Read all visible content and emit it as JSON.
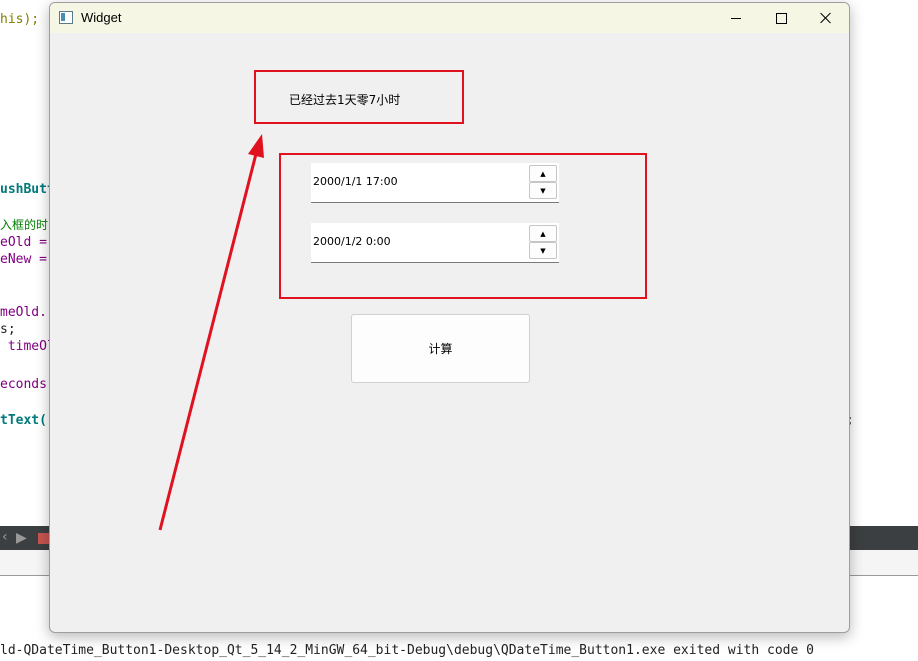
{
  "background_editor": {
    "fragments": [
      {
        "text": "his);",
        "cls": "olive"
      },
      {
        "text": "ushButt",
        "cls": "teal"
      },
      {
        "text": "入框的时",
        "cls": "green"
      },
      {
        "text": "eOld =",
        "cls": "purple"
      },
      {
        "text": "eNew =",
        "cls": "purple"
      },
      {
        "text": "meOld.",
        "cls": "purple"
      },
      {
        "text": "s;",
        "cls": ""
      },
      {
        "text": " timeOl",
        "cls": "purple"
      },
      {
        "text": "econds",
        "cls": "purple"
      },
      {
        "text": "tText(",
        "cls": "teal"
      },
      {
        "text": ";",
        "cls": ""
      }
    ],
    "toolbar_glyphs": [
      "‹",
      "▶"
    ]
  },
  "bottom_status": "ld-QDateTime_Button1-Desktop_Qt_5_14_2_MinGW_64_bit-Debug\\debug\\QDateTime_Button1.exe exited with code 0",
  "window": {
    "title": "Widget",
    "app_icon": "qt-window-icon",
    "controls": {
      "minimize": "minimize-icon",
      "maximize": "maximize-icon",
      "close": "close-icon"
    }
  },
  "result_label": "已经过去1天零7小时",
  "datetime_edits": [
    {
      "value": "2000/1/1 17:00",
      "up": "▲",
      "down": "▼"
    },
    {
      "value": "2000/1/2 0:00",
      "up": "▲",
      "down": "▼"
    }
  ],
  "calculate_button": "计算",
  "annotation_color": "#e0121f"
}
